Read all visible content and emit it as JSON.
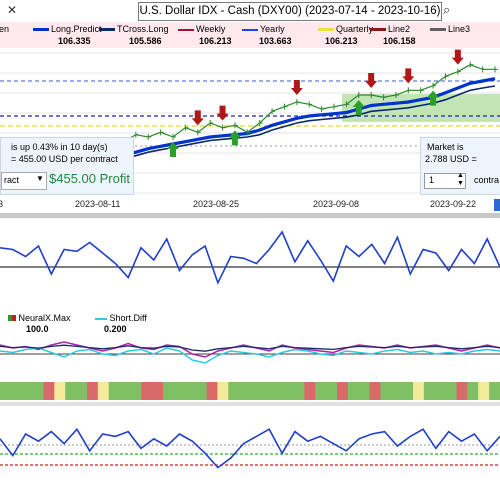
{
  "window": {
    "title": "U.S. Dollar IDX - Cash (DXY00) (2023-07-14 - 2023-10-16)",
    "close_symbol": "✕",
    "search_symbol": "⌕"
  },
  "legend": {
    "items": [
      {
        "label": "en",
        "value": "106.335",
        "color": "#ff2020"
      },
      {
        "label": "Long.Predict",
        "value": "",
        "color": "#0033cc"
      },
      {
        "label": "TCross.Long",
        "value": "105.586",
        "color": "#0a2a6a"
      },
      {
        "label": "Weekly",
        "value": "106.213",
        "color": "#a01030"
      },
      {
        "label": "Yearly",
        "value": "103.663",
        "color": "#2040ff"
      },
      {
        "label": "Quarterly",
        "value": "106.213",
        "color": "#f0e040"
      },
      {
        "label": "Line2",
        "value": "106.158",
        "color": "#8a1a1a"
      },
      {
        "label": "Line3",
        "value": "",
        "color": "#606060"
      }
    ]
  },
  "main_chart": {
    "x_labels": [
      "3",
      "2023-08-11",
      "2023-08-25",
      "2023-09-08",
      "2023-09-22"
    ],
    "colors": {
      "price": "#2a8a2a",
      "predict": "#0033cc",
      "tcross": "#0a2a6a",
      "down_arrow": "#b01818",
      "up_arrow": "#2aa02a"
    }
  },
  "trade_panel_left": {
    "line1": "is up 0.43% in 10 day(s)",
    "line2": "= 455.00 USD per contract",
    "select_label": "ract",
    "profit": "$455.00 Profit"
  },
  "trade_panel_right": {
    "line1": "Market is",
    "line2": "2.788 USD =",
    "qty": "1",
    "contract_label": "contra"
  },
  "neural": {
    "legend_1": "NeuralX.Max",
    "legend_2": "Short.Diff",
    "value_1": "100.0",
    "value_2": "0.200"
  },
  "chart_data": [
    {
      "type": "line",
      "title": "U.S. Dollar IDX - Cash (DXY00)",
      "x": [
        "2023-08-04",
        "2023-08-07",
        "2023-08-08",
        "2023-08-09",
        "2023-08-10",
        "2023-08-11",
        "2023-08-14",
        "2023-08-15",
        "2023-08-16",
        "2023-08-17",
        "2023-08-18",
        "2023-08-21",
        "2023-08-22",
        "2023-08-23",
        "2023-08-24",
        "2023-08-25",
        "2023-08-28",
        "2023-08-29",
        "2023-08-30",
        "2023-08-31",
        "2023-09-01",
        "2023-09-05",
        "2023-09-06",
        "2023-09-07",
        "2023-09-08",
        "2023-09-11",
        "2023-09-12",
        "2023-09-13",
        "2023-09-14",
        "2023-09-15",
        "2023-09-18",
        "2023-09-19",
        "2023-09-20",
        "2023-09-21",
        "2023-09-22",
        "2023-09-25",
        "2023-09-26",
        "2023-09-27",
        "2023-09-28",
        "2023-09-29"
      ],
      "series": [
        {
          "name": "Long.Predict",
          "values": [
            101.9,
            101.95,
            102.0,
            102.05,
            102.1,
            102.2,
            102.3,
            102.4,
            102.5,
            102.6,
            102.75,
            102.9,
            103.0,
            103.1,
            103.2,
            103.3,
            103.4,
            103.45,
            103.5,
            103.55,
            103.7,
            103.9,
            104.05,
            104.2,
            104.3,
            104.35,
            104.4,
            104.45,
            104.6,
            104.75,
            104.8,
            104.85,
            104.9,
            105.0,
            105.1,
            105.3,
            105.5,
            105.7,
            105.8,
            105.9
          ]
        },
        {
          "name": "TCross.Long",
          "values": [
            101.8,
            101.85,
            101.9,
            101.95,
            102.0,
            102.1,
            102.2,
            102.3,
            102.4,
            102.5,
            102.6,
            102.75,
            102.85,
            102.95,
            103.05,
            103.15,
            103.25,
            103.3,
            103.35,
            103.4,
            103.5,
            103.7,
            103.85,
            104.0,
            104.1,
            104.15,
            104.2,
            104.25,
            104.35,
            104.5,
            104.55,
            104.6,
            104.65,
            104.75,
            104.85,
            105.0,
            105.2,
            105.4,
            105.5,
            105.586
          ]
        },
        {
          "name": "Price",
          "values": [
            102.0,
            102.1,
            102.2,
            102.3,
            102.4,
            102.6,
            102.8,
            102.9,
            103.1,
            103.2,
            103.5,
            103.4,
            103.6,
            103.4,
            103.8,
            103.6,
            104.0,
            103.8,
            103.9,
            103.6,
            104.0,
            104.5,
            104.7,
            104.9,
            104.8,
            104.6,
            104.7,
            104.8,
            105.2,
            105.2,
            105.1,
            105.2,
            105.4,
            105.4,
            105.6,
            106.0,
            106.2,
            106.5,
            106.3,
            106.3
          ]
        }
      ],
      "ylim": [
        101.0,
        107.0
      ],
      "grid": true
    },
    {
      "type": "line",
      "series": [
        {
          "name": "Oscillator",
          "values": [
            0.55,
            0.5,
            0.3,
            0.6,
            -0.2,
            0.5,
            0.45,
            0.7,
            0.4,
            0.1,
            -0.3,
            0.55,
            0.2,
            0.8,
            -0.1,
            0.35,
            0.6,
            -0.45,
            0.3,
            0.25,
            0.1,
            0.5,
            1.0,
            0.15,
            0.75,
            0.2,
            -0.4,
            0.6,
            0.3,
            0.65,
            0.1,
            0.85,
            -0.2,
            0.5,
            0.4,
            -0.1,
            0.5,
            0.1,
            0.8,
            0.0
          ]
        }
      ],
      "ylim": [
        -1,
        1
      ]
    },
    {
      "type": "line",
      "series": [
        {
          "name": "NeuralX.Max",
          "values": [
            0.3,
            0.2,
            0.25,
            0.15,
            0.3,
            0.4,
            0.3,
            0.2,
            0.1,
            0.2,
            0.35,
            0.2,
            0.15,
            0.3,
            0.25,
            0.0,
            -0.1,
            0.1,
            0.2,
            0.3,
            0.2,
            0.1,
            0.3,
            0.2,
            0.15,
            0.1,
            0.05,
            0.2,
            0.3,
            0.25,
            0.2,
            0.3,
            0.2,
            0.25,
            0.3,
            0.2,
            0.1,
            0.2,
            0.3,
            0.2
          ]
        },
        {
          "name": "Short.Diff",
          "values": [
            0.1,
            0.05,
            0.15,
            0.2,
            0.05,
            -0.1,
            0.1,
            0.15,
            0.0,
            -0.05,
            0.1,
            0.15,
            0.0,
            0.2,
            0.1,
            -0.2,
            -0.3,
            -0.05,
            0.1,
            0.05,
            0.0,
            -0.1,
            0.05,
            0.15,
            0.1,
            0.0,
            -0.05,
            0.1,
            0.05,
            0.0,
            0.1,
            0.15,
            0.05,
            0.1,
            0.0,
            0.05,
            0.0,
            0.1,
            0.15,
            0.1
          ]
        }
      ],
      "ylim": [
        -1,
        1
      ]
    },
    {
      "type": "heatmap",
      "values": [
        "g",
        "g",
        "g",
        "g",
        "r",
        "y",
        "g",
        "g",
        "r",
        "y",
        "g",
        "g",
        "g",
        "r",
        "r",
        "g",
        "g",
        "g",
        "g",
        "r",
        "y",
        "g",
        "g",
        "g",
        "g",
        "g",
        "g",
        "g",
        "r",
        "g",
        "g",
        "r",
        "g",
        "g",
        "r",
        "g",
        "g",
        "g",
        "y",
        "g",
        "g",
        "g",
        "r",
        "g",
        "y",
        "g"
      ]
    },
    {
      "type": "line",
      "series": [
        {
          "name": "Cycle",
          "values": [
            0.3,
            -0.4,
            0.5,
            0.2,
            0.6,
            0.1,
            0.7,
            -0.2,
            0.5,
            0.4,
            0.6,
            -0.1,
            0.3,
            0.0,
            0.5,
            0.2,
            -0.3,
            -0.9,
            -0.5,
            0.1,
            0.4,
            0.7,
            -0.3,
            0.6,
            0.2,
            0.4,
            0.1,
            -0.2,
            0.3,
            0.5,
            0.6,
            0.0,
            0.4,
            0.7,
            -0.1,
            0.6,
            0.2,
            0.5,
            -0.2,
            0.4
          ]
        }
      ],
      "ylim": [
        -1,
        1
      ]
    }
  ]
}
